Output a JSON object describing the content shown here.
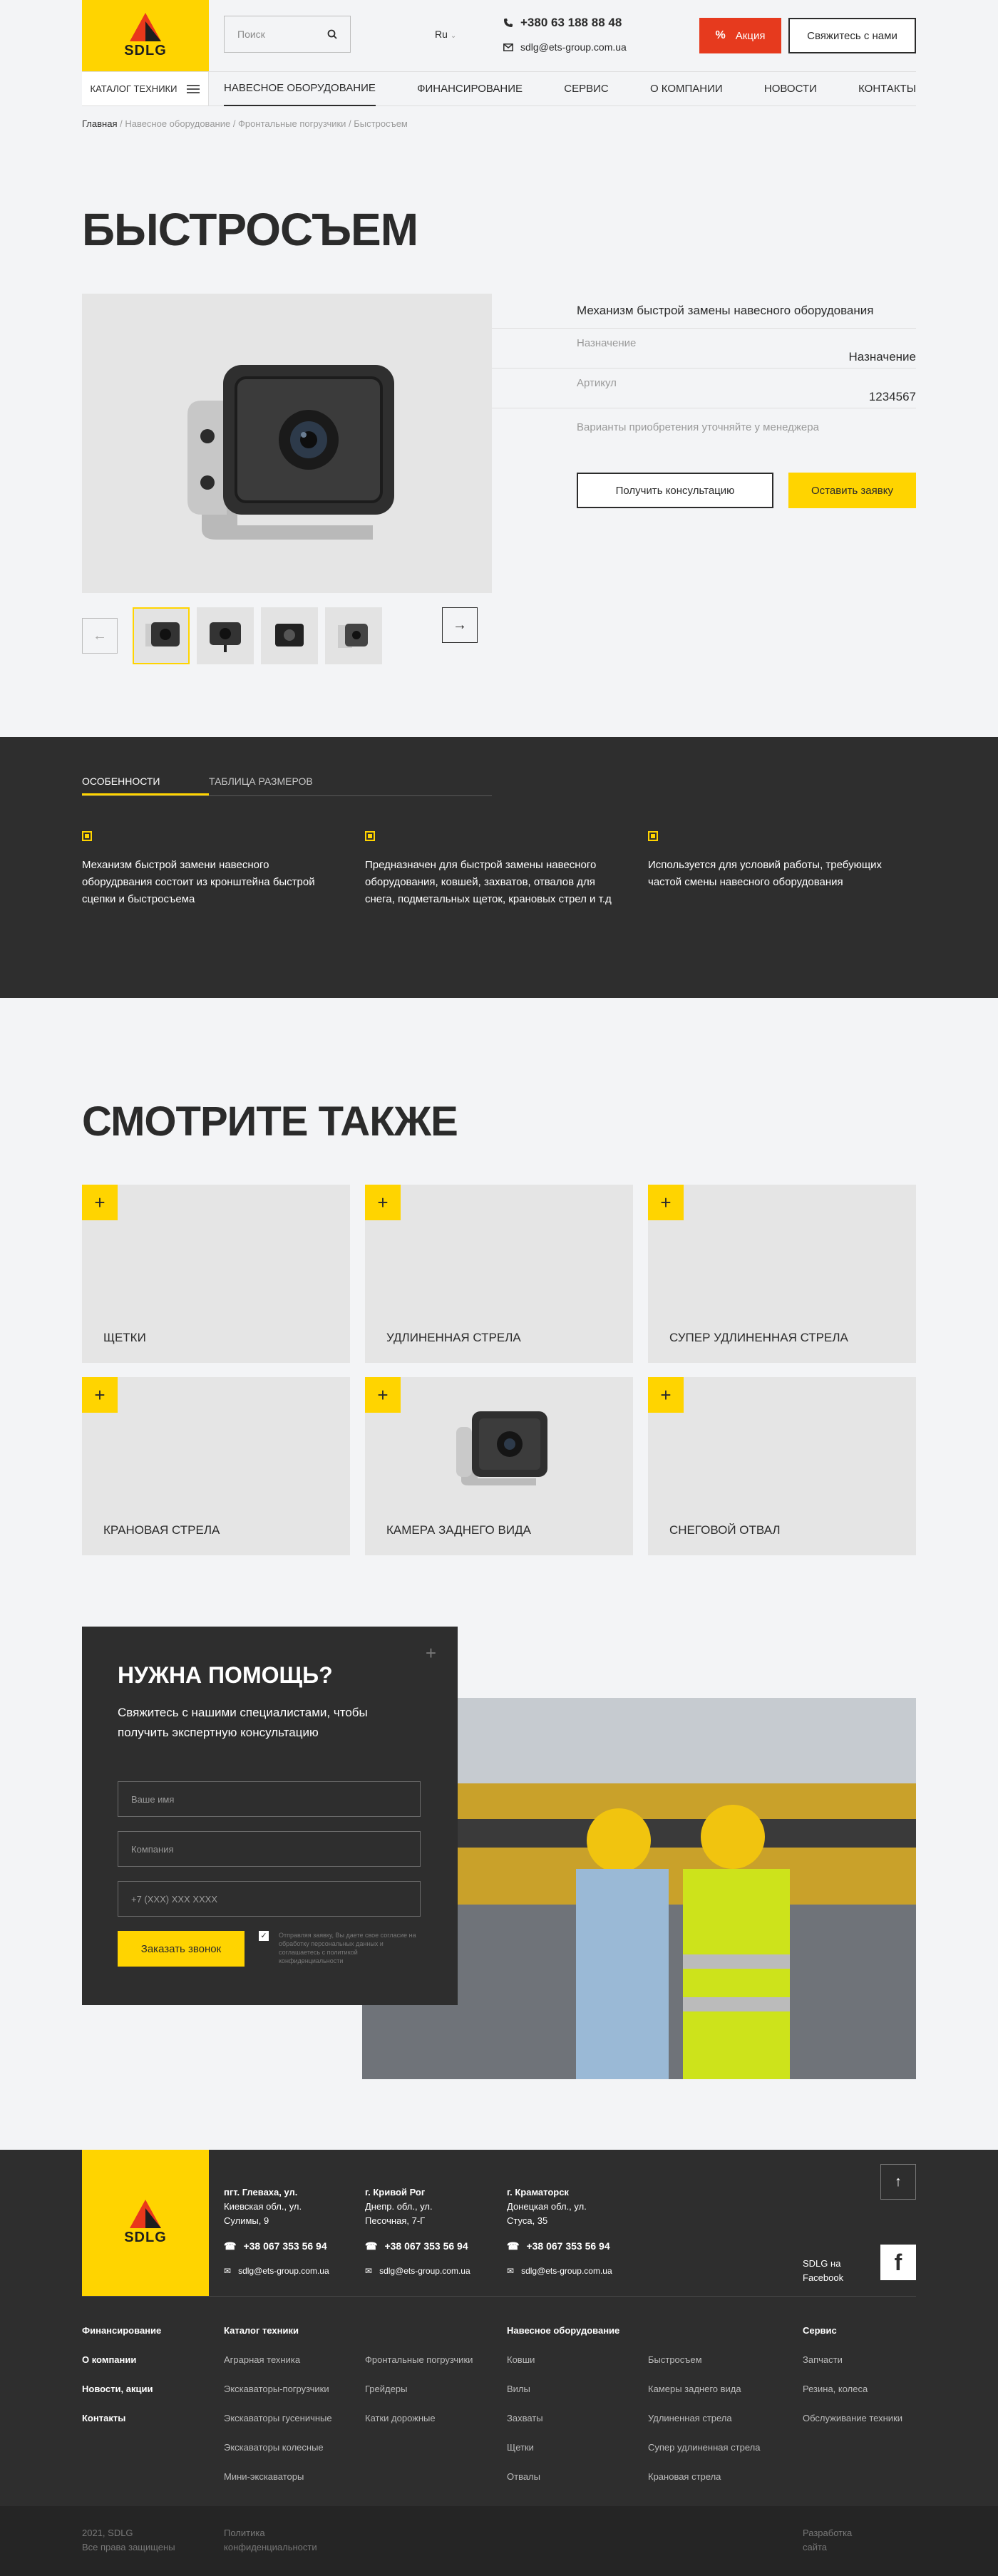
{
  "header": {
    "logo": "SDLG",
    "search_placeholder": "Поиск",
    "lang": "Ru",
    "phone": "+380 63 188 88 48",
    "email": "sdlg@ets-group.com.ua",
    "promo": "Акция",
    "contact": "Свяжитесь с нами",
    "catalog": "КАТАЛОГ ТЕХНИКИ",
    "nav": [
      "НАВЕСНОЕ ОБОРУДОВАНИЕ",
      "ФИНАНСИРОВАНИЕ",
      "СЕРВИС",
      "О КОМПАНИИ",
      "НОВОСТИ",
      "КОНТАКТЫ"
    ]
  },
  "breadcrumbs": {
    "home": "Главная",
    "rest": " / Навесное оборудование / Фронтальные погрузчики / Быстросъем"
  },
  "product": {
    "title": "БЫСТРОСЪЕМ",
    "desc": "Механизм быстрой замены навесного оборудования",
    "purpose_label": "Назначение",
    "purpose_value": "Назначение",
    "sku_label": "Артикул",
    "sku_value": "1234567",
    "note": "Варианты приобретения уточняйте у менеджера",
    "btn_consult": "Получить консультацию",
    "btn_order": "Оставить заявку"
  },
  "features": {
    "tabs": [
      "ОСОБЕННОСТИ",
      "ТАБЛИЦА РАЗМЕРОВ"
    ],
    "items": [
      "Механизм быстрой замени навесного оборудрвания состоит из кронштейна быстрой сцепки и быстросъема",
      "Предназначен для быстрой замены навесного оборудования, ковшей, захватов, отвалов для снега, подметальных щеток, крановых стрел и т.д",
      "Используется для условий работы, требующих частой смены навесного оборудования"
    ]
  },
  "see_also": {
    "title": "СМОТРИТЕ ТАКЖЕ",
    "cards": [
      "ЩЕТКИ",
      "УДЛИНЕННАЯ СТРЕЛА",
      "СУПЕР УДЛИНЕННАЯ СТРЕЛА",
      "КРАНОВАЯ СТРЕЛА",
      "КАМЕРА ЗАДНЕГО ВИДА",
      "СНЕГОВОЙ ОТВАЛ"
    ]
  },
  "help": {
    "title": "НУЖНА ПОМОЩЬ?",
    "text": "Свяжитесь с нашими специалистами, чтобы получить экспертную консультацию",
    "name_ph": "Ваше имя",
    "company_ph": "Компания",
    "phone_ph": "+7 (XXX) XXX XXXX",
    "btn": "Заказать звонок",
    "agree": "Отправляя заявку, Вы даете свое согласие на обработку персональных данных и соглашаетесь с политикой конфиденциальности"
  },
  "footer": {
    "offices": [
      {
        "city": "пгт. Глеваха, ул.",
        "addr": "Киевская обл., ул. Сулимы, 9",
        "phone": "+38 067 353 56 94",
        "email": "sdlg@ets-group.com.ua"
      },
      {
        "city": "г. Кривой Рог",
        "addr": "Днепр. обл., ул. Песочная, 7-Г",
        "phone": "+38 067 353 56 94",
        "email": "sdlg@ets-group.com.ua"
      },
      {
        "city": "г. Краматорск",
        "addr": "Донецкая обл., ул. Стуса, 35",
        "phone": "+38 067 353 56 94",
        "email": "sdlg@ets-group.com.ua"
      }
    ],
    "facebook": "SDLG на Facebook",
    "col1": [
      "Финансирование",
      "О компании",
      "Новости, акции",
      "Контакты"
    ],
    "catalog_title": "Каталог техники",
    "catalog_a": [
      "Аграрная техника",
      "Экскаваторы-погрузчики",
      "Экскаваторы гусеничные",
      "Экскаваторы колесные",
      "Мини-экскаваторы"
    ],
    "catalog_b": [
      "Фронтальные погрузчики",
      "Грейдеры",
      "Катки дорожные"
    ],
    "equip_title": "Навесное оборудование",
    "equip_a": [
      "Ковши",
      "Вилы",
      "Захваты",
      "Щетки",
      "Отвалы"
    ],
    "equip_b": [
      "Быстросъем",
      "Камеры заднего вида",
      "Удлиненная стрела",
      "Супер удлиненная стрела",
      "Крановая стрела"
    ],
    "service_title": "Сервис",
    "service": [
      "Запчасти",
      "Резина, колеса",
      "Обслуживание техники"
    ],
    "copy1": "2021, SDLG",
    "copy2": "Все права защищены",
    "policy1": "Политика",
    "policy2": "конфиденциальности",
    "dev1": "Разработка",
    "dev2": "сайта"
  }
}
